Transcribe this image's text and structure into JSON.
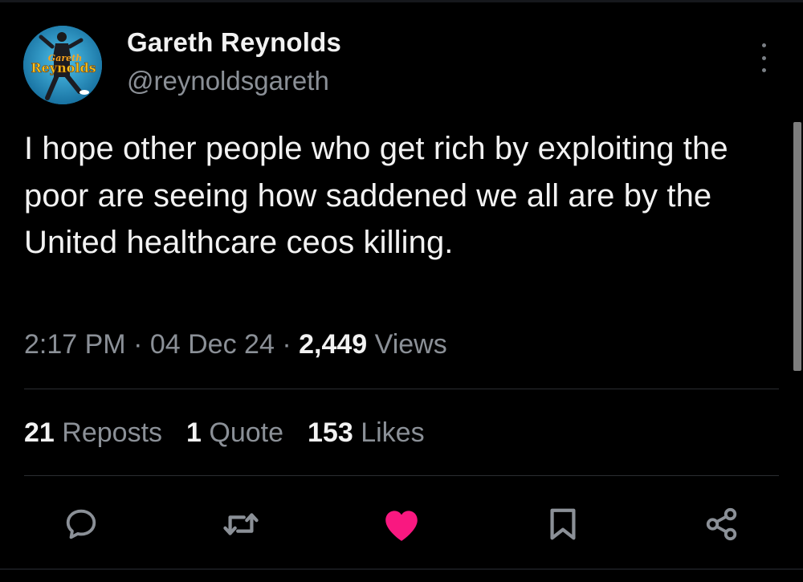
{
  "author": {
    "name": "Gareth Reynolds",
    "handle": "@reynoldsgareth",
    "avatar_text_top": "Gareth",
    "avatar_text_bottom": "Reynolds"
  },
  "tweet": {
    "text": "I hope other people who get rich by exploiting the poor are seeing how saddened we all are by the United healthcare ceos killing.",
    "time": "2:17 PM",
    "date": "04 Dec 24",
    "views_count": "2,449",
    "views_label": "Views",
    "separator": "·"
  },
  "stats": {
    "reposts_count": "21",
    "reposts_label": "Reposts",
    "quotes_count": "1",
    "quotes_label": "Quote",
    "likes_count": "153",
    "likes_label": "Likes"
  },
  "actions": [
    {
      "name": "reply",
      "icon": "speech-bubble-icon"
    },
    {
      "name": "repost",
      "icon": "repost-arrows-icon"
    },
    {
      "name": "like",
      "icon": "heart-icon",
      "active": true
    },
    {
      "name": "bookmark",
      "icon": "bookmark-icon"
    },
    {
      "name": "share",
      "icon": "share-icon"
    }
  ],
  "colors": {
    "background": "#000000",
    "text_primary": "#f2f2f2",
    "text_secondary": "#8b9097",
    "like_active": "#f91880",
    "icon_default": "#8b9097",
    "divider": "#2a2d31"
  }
}
